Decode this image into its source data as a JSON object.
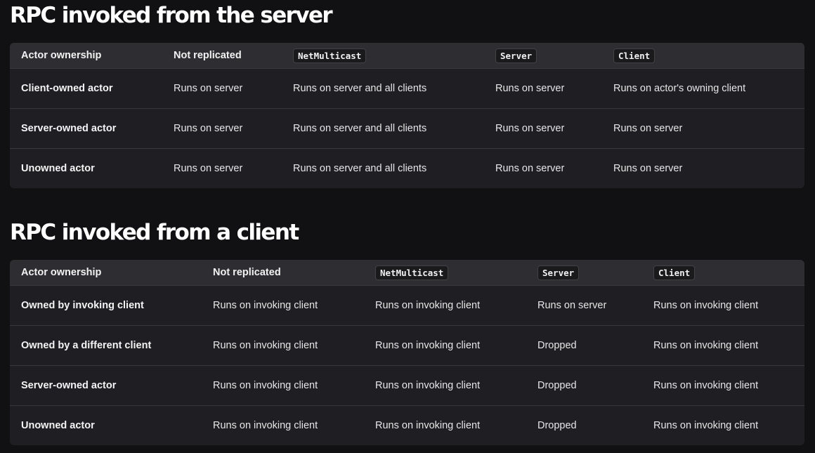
{
  "sections": [
    {
      "title": "RPC invoked from the server",
      "headers": {
        "col0": "Actor ownership",
        "col1": "Not replicated",
        "col2": "NetMulticast",
        "col3": "Server",
        "col4": "Client"
      },
      "rows": [
        [
          "Client-owned actor",
          "Runs on server",
          "Runs on server and all clients",
          "Runs on server",
          "Runs on actor's owning client"
        ],
        [
          "Server-owned actor",
          "Runs on server",
          "Runs on server and all clients",
          "Runs on server",
          "Runs on server"
        ],
        [
          "Unowned actor",
          "Runs on server",
          "Runs on server and all clients",
          "Runs on server",
          "Runs on server"
        ]
      ]
    },
    {
      "title": "RPC invoked from a client",
      "headers": {
        "col0": "Actor ownership",
        "col1": "Not replicated",
        "col2": "NetMulticast",
        "col3": "Server",
        "col4": "Client"
      },
      "rows": [
        [
          "Owned by invoking client",
          "Runs on invoking client",
          "Runs on invoking client",
          "Runs on server",
          "Runs on invoking client"
        ],
        [
          "Owned by a different client",
          "Runs on invoking client",
          "Runs on invoking client",
          "Dropped",
          "Runs on invoking client"
        ],
        [
          "Server-owned actor",
          "Runs on invoking client",
          "Runs on invoking client",
          "Dropped",
          "Runs on invoking client"
        ],
        [
          "Unowned actor",
          "Runs on invoking client",
          "Runs on invoking client",
          "Dropped",
          "Runs on invoking client"
        ]
      ]
    }
  ]
}
